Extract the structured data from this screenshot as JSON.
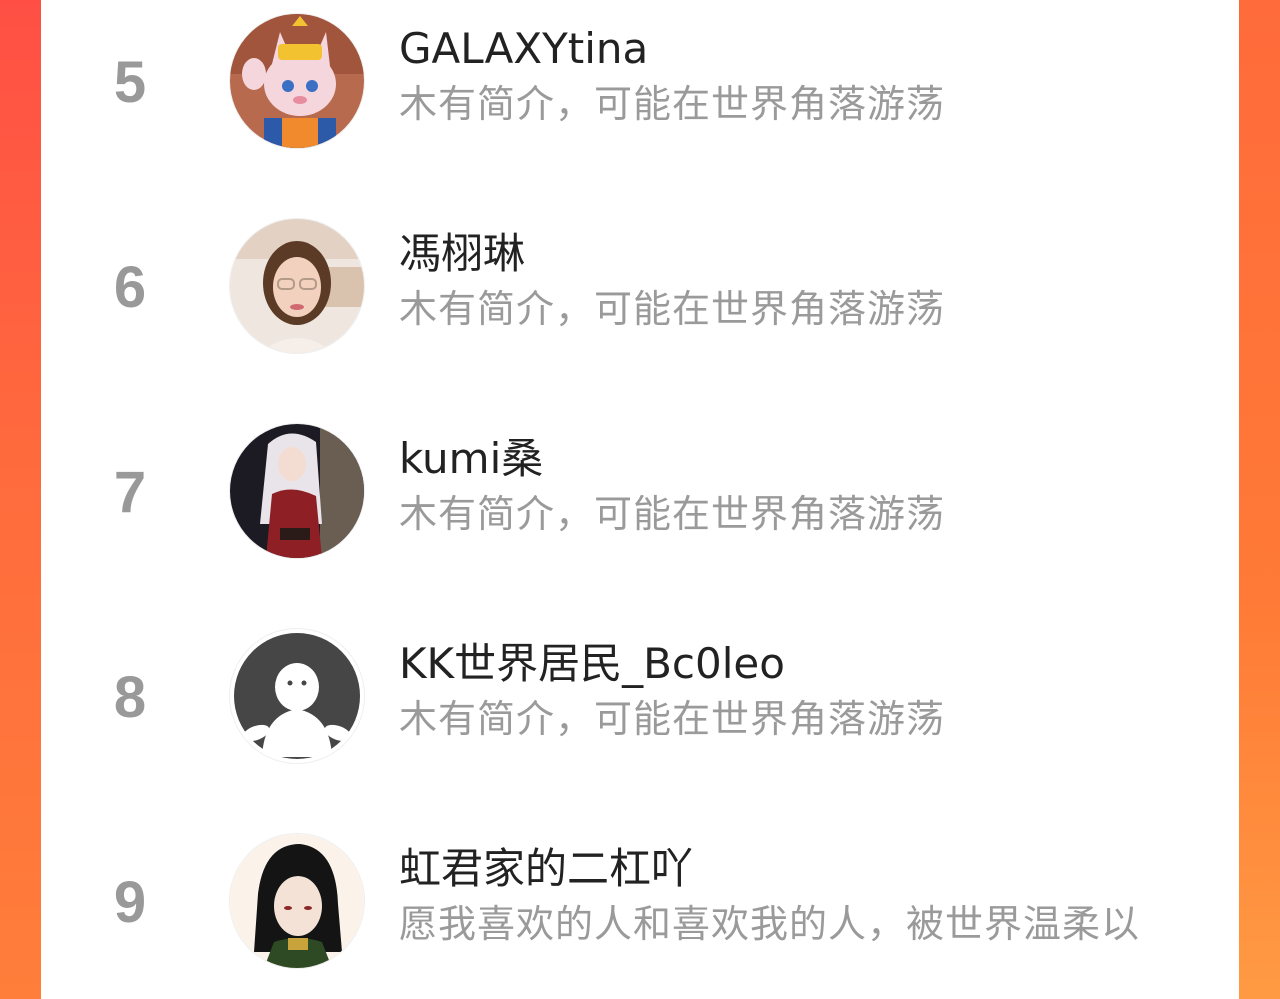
{
  "colors": {
    "frame_gradient_top": "#ff4f45",
    "frame_gradient_bottom": "#ff7e3a",
    "panel_background": "#ffffff",
    "rank_color": "#999999",
    "name_color": "#222222",
    "bio_color": "#9a9a9a"
  },
  "list": {
    "items": [
      {
        "rank": "5",
        "name": "GALAXYtina",
        "bio": "木有简介，可能在世界角落游荡",
        "avatar": "plush-mascot-avatar"
      },
      {
        "rank": "6",
        "name": "馮栩琳",
        "bio": "木有简介，可能在世界角落游荡",
        "avatar": "portrait-photo-avatar"
      },
      {
        "rank": "7",
        "name": "kumi桑",
        "bio": "木有简介，可能在世界角落游荡",
        "avatar": "anime-character-avatar"
      },
      {
        "rank": "8",
        "name": "KK世界居民_Bc0leo",
        "bio": "木有简介，可能在世界角落游荡",
        "avatar": "default-user-avatar"
      },
      {
        "rank": "9",
        "name": "虹君家的二杠吖",
        "bio": "愿我喜欢的人和喜欢我的人，被世界温柔以",
        "avatar": "anime-portrait-avatar"
      }
    ]
  }
}
